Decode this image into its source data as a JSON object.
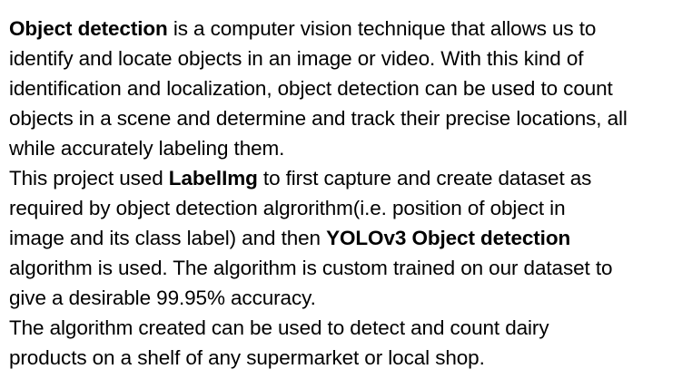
{
  "paragraphs": [
    {
      "lines": [
        [
          {
            "text": "Object detection",
            "bold": true
          },
          {
            "text": " is a computer vision technique that allows us to",
            "bold": false
          }
        ],
        [
          {
            "text": "identify and locate objects in an image or video. With this kind of",
            "bold": false
          }
        ],
        [
          {
            "text": "identification and localization, object detection can be used to count",
            "bold": false
          }
        ],
        [
          {
            "text": "objects in a scene and determine and track their precise locations, all",
            "bold": false
          }
        ],
        [
          {
            "text": "while accurately labeling them.",
            "bold": false
          }
        ]
      ]
    },
    {
      "lines": [
        [
          {
            "text": "This project used ",
            "bold": false
          },
          {
            "text": "LabelImg",
            "bold": true
          },
          {
            "text": " to first capture and create dataset as",
            "bold": false
          }
        ],
        [
          {
            "text": "required by object detection algrorithm(i.e. position of object in",
            "bold": false
          }
        ],
        [
          {
            "text": "image and its class label) and then ",
            "bold": false
          },
          {
            "text": "YOLOv3 Object detection",
            "bold": true
          }
        ],
        [
          {
            "text": "algorithm is used. The algorithm is custom trained on our dataset to",
            "bold": false
          }
        ],
        [
          {
            "text": "give a desirable 99.95% accuracy.",
            "bold": false
          }
        ]
      ]
    },
    {
      "lines": [
        [
          {
            "text": "The algorithm created can be used to detect and count dairy",
            "bold": false
          }
        ],
        [
          {
            "text": "products on a shelf of any supermarket or local shop.",
            "bold": false
          }
        ]
      ]
    }
  ]
}
